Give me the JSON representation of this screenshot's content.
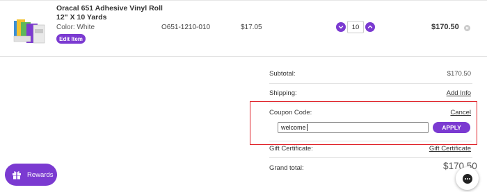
{
  "cart_item": {
    "name": "Oracal 651 Adhesive Vinyl Roll 12\" X 10 Yards",
    "color": "Color: White",
    "edit_label": "Edit Item",
    "sku": "O651-1210-010",
    "price": "$17.05",
    "quantity": "10",
    "total": "$170.50",
    "thumbnail_icon": "vinyl-roll-product-image"
  },
  "summary": {
    "subtotal_label": "Subtotal:",
    "subtotal_value": "$170.50",
    "shipping_label": "Shipping:",
    "shipping_link": "Add Info",
    "coupon_label": "Coupon Code:",
    "coupon_cancel": "Cancel",
    "coupon_value": "welcome",
    "apply_label": "APPLY",
    "gift_label": "Gift Certificate:",
    "gift_link": "Gift Certificate",
    "grand_label": "Grand total:",
    "grand_value": "$170.50"
  },
  "widgets": {
    "rewards_label": "Rewards",
    "rewards_icon": "gift-icon",
    "chat_icon": "chat-icon"
  },
  "colors": {
    "accent": "#7b3ad1",
    "highlight_border": "#e0242b"
  }
}
